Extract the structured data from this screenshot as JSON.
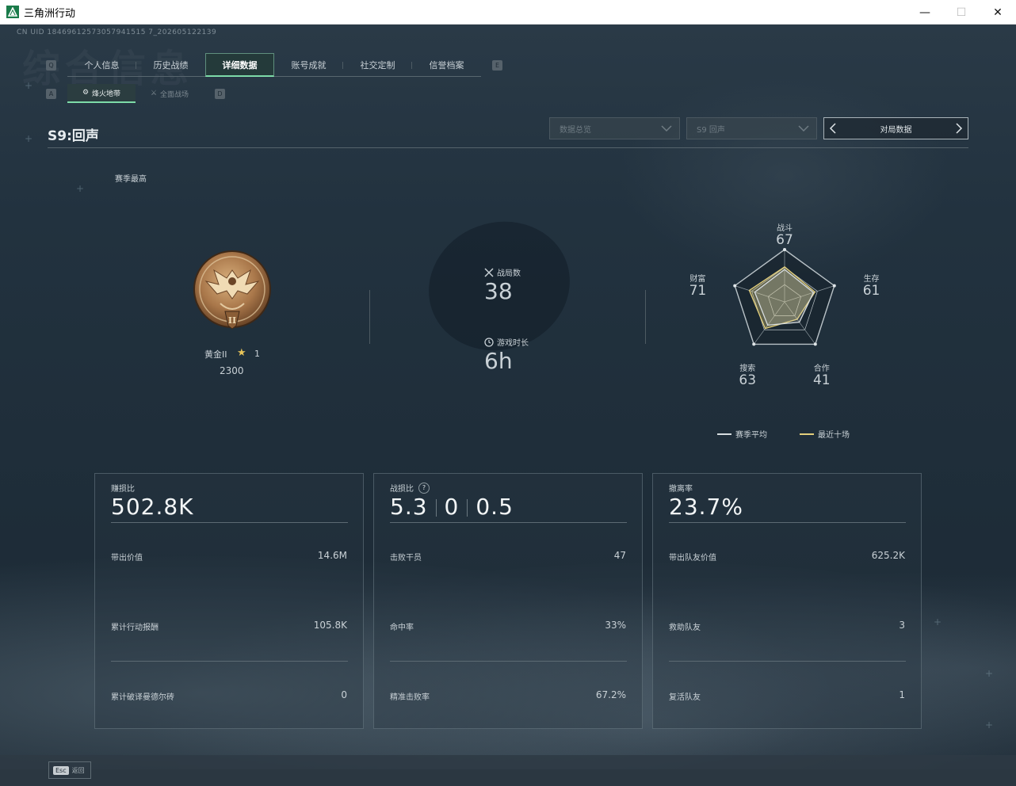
{
  "window": {
    "title": "三角洲行动",
    "minimize": "—",
    "maximize": "☐",
    "close": "✕"
  },
  "header": {
    "id_line": "CN UID 18469612573057941515 7_202605122139",
    "bg_watermark": "综合信息"
  },
  "tabs": {
    "left_key": "Q",
    "right_key": "E",
    "items": [
      {
        "label": "个人信息"
      },
      {
        "label": "历史战绩"
      },
      {
        "label": "详细数据"
      },
      {
        "label": "账号成就"
      },
      {
        "label": "社交定制"
      },
      {
        "label": "信誉档案"
      }
    ],
    "active_index": 2
  },
  "subtabs": {
    "left_key": "A",
    "right_key": "D",
    "items": [
      {
        "label": "烽火地带",
        "icon": "fire-zone-icon"
      },
      {
        "label": "全面战场",
        "icon": "battlefield-icon"
      }
    ],
    "active_index": 0
  },
  "season": {
    "title": "S9:回声",
    "dropdown_data": "数据总览",
    "dropdown_season": "S9 回声",
    "stepper_label": "对局数据",
    "best_label": "赛季最高"
  },
  "rank": {
    "name": "黄金II",
    "stars": "1",
    "score": "2300",
    "badge_numeral": "II"
  },
  "stats": {
    "matches_label": "战局数",
    "matches_value": "38",
    "time_label": "游戏时长",
    "time_value": "6h"
  },
  "radar": {
    "axes": [
      {
        "label": "战斗",
        "value": "67"
      },
      {
        "label": "生存",
        "value": "61"
      },
      {
        "label": "合作",
        "value": "41"
      },
      {
        "label": "搜索",
        "value": "63"
      },
      {
        "label": "财富",
        "value": "71"
      }
    ],
    "season_avg": [
      0.62,
      0.58,
      0.48,
      0.55,
      0.6
    ],
    "recent_ten": [
      0.67,
      0.61,
      0.41,
      0.63,
      0.71
    ],
    "legend": [
      {
        "label": "赛季平均",
        "color": "#d7dde0"
      },
      {
        "label": "最近十场",
        "color": "#e3cf7c"
      }
    ]
  },
  "cards": [
    {
      "label": "赚损比",
      "big": "502.8K",
      "rows": [
        {
          "label": "带出价值",
          "value": "14.6M"
        },
        {
          "label": "累计行动报酬",
          "value": "105.8K"
        },
        {
          "label": "累计破译曼德尔砖",
          "value": "0"
        }
      ]
    },
    {
      "label": "战损比",
      "help": "?",
      "big_parts": [
        "5.3",
        "0",
        "0.5"
      ],
      "rows": [
        {
          "label": "击败干员",
          "value": "47"
        },
        {
          "label": "命中率",
          "value": "33%"
        },
        {
          "label": "精准击败率",
          "value": "67.2%"
        }
      ]
    },
    {
      "label": "撤离率",
      "big": "23.7%",
      "rows": [
        {
          "label": "带出队友价值",
          "value": "625.2K"
        },
        {
          "label": "救助队友",
          "value": "3"
        },
        {
          "label": "复活队友",
          "value": "1"
        }
      ]
    }
  ],
  "footer": {
    "esc_key": "Esc",
    "esc_label": "返回"
  },
  "colors": {
    "accent": "#7ddba8",
    "radar_recent": "#e3cf7c",
    "radar_avg": "#d7dde0"
  }
}
